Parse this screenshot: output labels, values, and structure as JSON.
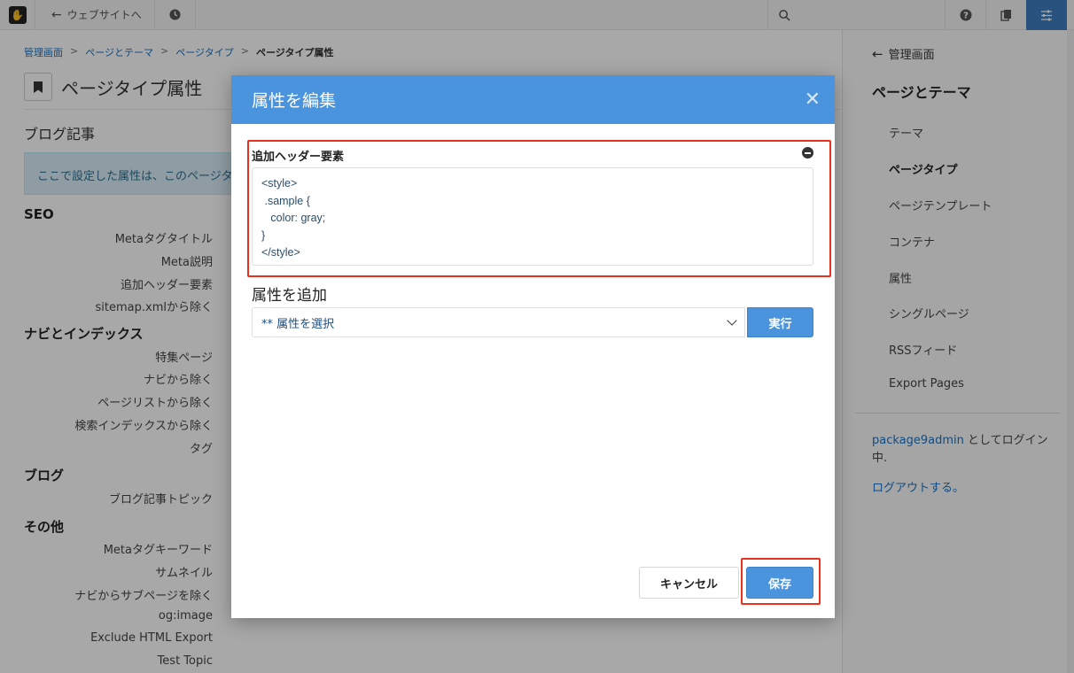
{
  "topbar": {
    "back_label": "ウェブサイトへ",
    "logo_icon": "concrete-hand-logo",
    "search_icon": "search-icon",
    "help_icon": "question-circle-icon",
    "pages_icon": "pages-icon",
    "settings_icon": "sliders-icon",
    "accent": "#3f7ec0"
  },
  "breadcrumb": {
    "items": [
      "管理画面",
      "ページとテーマ",
      "ページタイプ"
    ],
    "current": "ページタイプ属性"
  },
  "page": {
    "title": "ページタイプ属性",
    "subtitle": "ブログ記事",
    "alert": "ここで設定した属性は、このページタイ"
  },
  "groups": {
    "seo": {
      "title": "SEO",
      "items": [
        "Metaタグタイトル",
        "Meta説明",
        "追加ヘッダー要素",
        "sitemap.xmlから除く"
      ]
    },
    "nav": {
      "title": "ナビとインデックス",
      "items": [
        "特集ページ",
        "ナビから除く",
        "ページリストから除く",
        "検索インデックスから除く",
        "タグ"
      ]
    },
    "blog": {
      "title": "ブログ",
      "items": [
        "ブログ記事トピック"
      ]
    },
    "other": {
      "title": "その他",
      "items": [
        "Metaタグキーワード",
        "サムネイル",
        "ナビからサブページを除く",
        "og:image",
        "Exclude HTML Export",
        "Test Topic"
      ]
    }
  },
  "right_panel": {
    "back_label": "管理画面",
    "title": "ページとテーマ",
    "items": [
      "テーマ",
      "ページタイプ",
      "ページテンプレート",
      "コンテナ",
      "属性",
      "シングルページ",
      "RSSフィード",
      "Export Pages"
    ],
    "active_index": 1,
    "login_user": "package9admin",
    "login_suffix": " としてログイン中.",
    "logout": "ログアウトする。"
  },
  "modal": {
    "title": "属性を編集",
    "field_label": "追加ヘッダー要素",
    "field_value": "<style>\n .sample {\n   color: gray;\n}\n</style>",
    "add_title": "属性を追加",
    "select_value": "** 属性を選択",
    "run_label": "実行",
    "cancel_label": "キャンセル",
    "save_label": "保存",
    "header_color": "#4a93dd",
    "highlight_color": "#e8321f"
  }
}
